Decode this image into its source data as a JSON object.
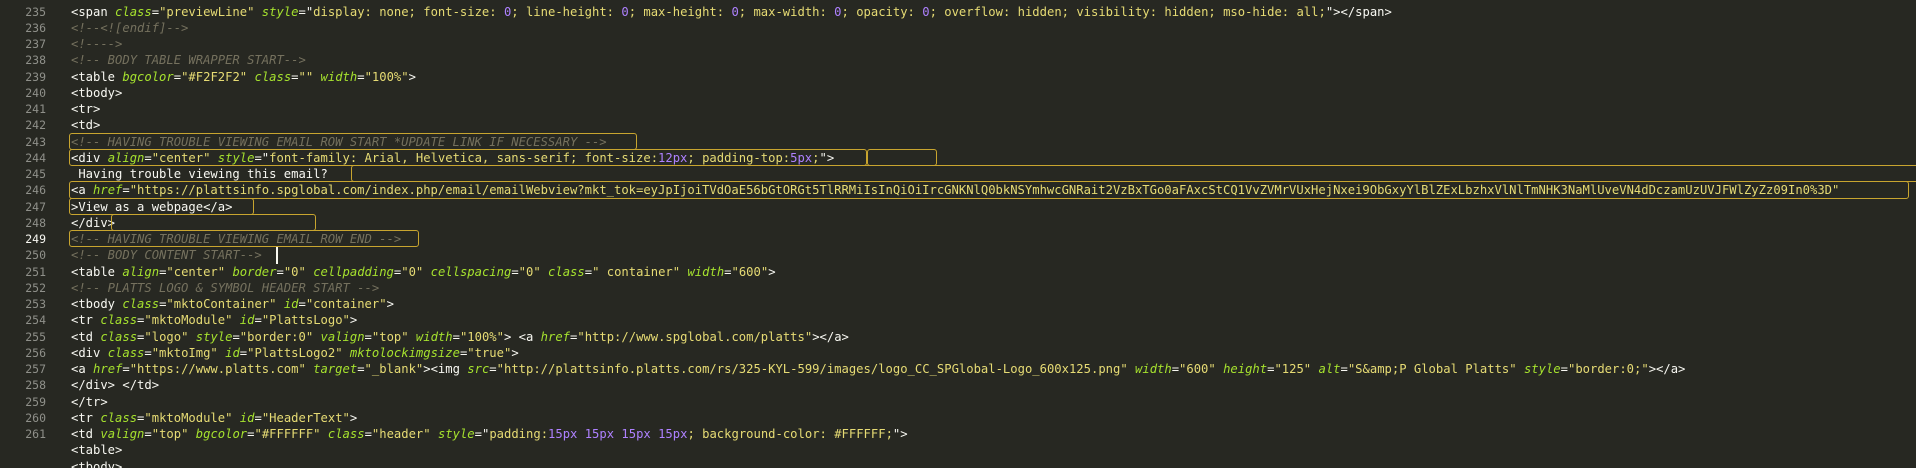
{
  "gutter": {
    "numbers": [
      "235",
      "236",
      "237",
      "238",
      "239",
      "240",
      "241",
      "242",
      "243",
      "244",
      "245",
      "246",
      "247",
      "248",
      "249",
      "250",
      "251",
      "252",
      "253",
      "254",
      "255",
      "256",
      "257",
      "258",
      "259",
      "260",
      "261"
    ],
    "active": "249"
  },
  "lines": [
    [
      [
        "t",
        "<span "
      ],
      [
        "a",
        "class"
      ],
      [
        "t",
        "="
      ],
      [
        "s",
        "\"previewLine\""
      ],
      [
        "t",
        " "
      ],
      [
        "a",
        "style"
      ],
      [
        "t",
        "=\""
      ],
      [
        "s",
        "display: none; font-size: "
      ],
      [
        "n",
        "0"
      ],
      [
        "s",
        "; line-height: "
      ],
      [
        "n",
        "0"
      ],
      [
        "s",
        "; max-height: "
      ],
      [
        "n",
        "0"
      ],
      [
        "s",
        "; max-width: "
      ],
      [
        "n",
        "0"
      ],
      [
        "s",
        "; opacity: "
      ],
      [
        "n",
        "0"
      ],
      [
        "s",
        "; overflow: hidden; visibility: hidden; mso-hide: all;"
      ],
      [
        "t",
        "\"></span>"
      ]
    ],
    [
      [
        "c",
        "<!--<![endif]-->"
      ]
    ],
    [
      [
        "c",
        "<!---->"
      ]
    ],
    [
      [
        "c",
        "<!-- BODY TABLE WRAPPER START-->"
      ]
    ],
    [
      [
        "t",
        "<table "
      ],
      [
        "a",
        "bgcolor"
      ],
      [
        "t",
        "="
      ],
      [
        "s",
        "\"#F2F2F2\""
      ],
      [
        "t",
        " "
      ],
      [
        "a",
        "class"
      ],
      [
        "t",
        "="
      ],
      [
        "s",
        "\"\""
      ],
      [
        "t",
        " "
      ],
      [
        "a",
        "width"
      ],
      [
        "t",
        "="
      ],
      [
        "s",
        "\"100%\""
      ],
      [
        "t",
        ">"
      ]
    ],
    [
      [
        "t",
        "<tbody>"
      ]
    ],
    [
      [
        "t",
        "<tr>"
      ]
    ],
    [
      [
        "t",
        "<td>"
      ]
    ],
    [
      [
        "c",
        "<!-- HAVING TROUBLE VIEWING EMAIL ROW START *UPDATE LINK IF NECESSARY -->"
      ]
    ],
    [
      [
        "t",
        "<div "
      ],
      [
        "a",
        "align"
      ],
      [
        "t",
        "="
      ],
      [
        "s",
        "\"center\""
      ],
      [
        "t",
        " "
      ],
      [
        "a",
        "style"
      ],
      [
        "t",
        "=\""
      ],
      [
        "s",
        "font-family: Arial, Helvetica, sans-serif; font-size:"
      ],
      [
        "n",
        "12px"
      ],
      [
        "s",
        "; padding-top:"
      ],
      [
        "n",
        "5px"
      ],
      [
        "s",
        ";"
      ],
      [
        "t",
        "\">"
      ]
    ],
    [
      [
        "t",
        " Having trouble viewing this email?"
      ]
    ],
    [
      [
        "t",
        "<a "
      ],
      [
        "a",
        "href"
      ],
      [
        "t",
        "="
      ],
      [
        "s",
        "\"https://plattsinfo.spglobal.com/index.php/email/emailWebview?mkt_tok=eyJpIjoiTVdOaE56bGtORGt5TlRRMiIsInQiOiIrcGNKNlQ0bkNSYmhwcGNRait2VzBxTGo0aFAxcStCQ1VvZVMrVUxHejNxei9ObGxyYlBlZExLbzhxVlNlTmNHK3NaMlUveVN4dDczamUzUVJFWlZyZz09In0%3D\""
      ]
    ],
    [
      [
        "t",
        ">View as a webpage</a>"
      ]
    ],
    [
      [
        "t",
        "</div>"
      ]
    ],
    [
      [
        "c",
        "<!-- HAVING TROUBLE VIEWING EMAIL ROW END -->"
      ]
    ],
    [
      [
        "c",
        "<!-- BODY CONTENT START-->"
      ]
    ],
    [
      [
        "t",
        "<table "
      ],
      [
        "a",
        "align"
      ],
      [
        "t",
        "="
      ],
      [
        "s",
        "\"center\""
      ],
      [
        "t",
        " "
      ],
      [
        "a",
        "border"
      ],
      [
        "t",
        "="
      ],
      [
        "s",
        "\"0\""
      ],
      [
        "t",
        " "
      ],
      [
        "a",
        "cellpadding"
      ],
      [
        "t",
        "="
      ],
      [
        "s",
        "\"0\""
      ],
      [
        "t",
        " "
      ],
      [
        "a",
        "cellspacing"
      ],
      [
        "t",
        "="
      ],
      [
        "s",
        "\"0\""
      ],
      [
        "t",
        " "
      ],
      [
        "a",
        "class"
      ],
      [
        "t",
        "="
      ],
      [
        "s",
        "\" container\""
      ],
      [
        "t",
        " "
      ],
      [
        "a",
        "width"
      ],
      [
        "t",
        "="
      ],
      [
        "s",
        "\"600\""
      ],
      [
        "t",
        ">"
      ]
    ],
    [
      [
        "c",
        "<!-- PLATTS LOGO & SYMBOL HEADER START -->"
      ]
    ],
    [
      [
        "t",
        "<tbody "
      ],
      [
        "a",
        "class"
      ],
      [
        "t",
        "="
      ],
      [
        "s",
        "\"mktoContainer\""
      ],
      [
        "t",
        " "
      ],
      [
        "a",
        "id"
      ],
      [
        "t",
        "="
      ],
      [
        "s",
        "\"container\""
      ],
      [
        "t",
        ">"
      ]
    ],
    [
      [
        "t",
        "<tr "
      ],
      [
        "a",
        "class"
      ],
      [
        "t",
        "="
      ],
      [
        "s",
        "\"mktoModule\""
      ],
      [
        "t",
        " "
      ],
      [
        "a",
        "id"
      ],
      [
        "t",
        "="
      ],
      [
        "s",
        "\"PlattsLogo\""
      ],
      [
        "t",
        ">"
      ]
    ],
    [
      [
        "t",
        "<td "
      ],
      [
        "a",
        "class"
      ],
      [
        "t",
        "="
      ],
      [
        "s",
        "\"logo\""
      ],
      [
        "t",
        " "
      ],
      [
        "a",
        "style"
      ],
      [
        "t",
        "="
      ],
      [
        "s",
        "\"border:0\""
      ],
      [
        "t",
        " "
      ],
      [
        "a",
        "valign"
      ],
      [
        "t",
        "="
      ],
      [
        "s",
        "\"top\""
      ],
      [
        "t",
        " "
      ],
      [
        "a",
        "width"
      ],
      [
        "t",
        "="
      ],
      [
        "s",
        "\"100%\""
      ],
      [
        "t",
        "> <a "
      ],
      [
        "a",
        "href"
      ],
      [
        "t",
        "="
      ],
      [
        "s",
        "\"http://www.spglobal.com/platts\""
      ],
      [
        "t",
        "></a>"
      ]
    ],
    [
      [
        "t",
        "<div "
      ],
      [
        "a",
        "class"
      ],
      [
        "t",
        "="
      ],
      [
        "s",
        "\"mktoImg\""
      ],
      [
        "t",
        " "
      ],
      [
        "a",
        "id"
      ],
      [
        "t",
        "="
      ],
      [
        "s",
        "\"PlattsLogo2\""
      ],
      [
        "t",
        " "
      ],
      [
        "a",
        "mktolockimgsize"
      ],
      [
        "t",
        "="
      ],
      [
        "s",
        "\"true\""
      ],
      [
        "t",
        ">"
      ]
    ],
    [
      [
        "t",
        "<a "
      ],
      [
        "a",
        "href"
      ],
      [
        "t",
        "="
      ],
      [
        "s",
        "\"https://www.platts.com\""
      ],
      [
        "t",
        " "
      ],
      [
        "a",
        "target"
      ],
      [
        "t",
        "="
      ],
      [
        "s",
        "\"_blank\""
      ],
      [
        "t",
        "><img "
      ],
      [
        "a",
        "src"
      ],
      [
        "t",
        "="
      ],
      [
        "s",
        "\"http://plattsinfo.platts.com/rs/325-KYL-599/images/logo_CC_SPGlobal-Logo_600x125.png\""
      ],
      [
        "t",
        " "
      ],
      [
        "a",
        "width"
      ],
      [
        "t",
        "="
      ],
      [
        "s",
        "\"600\""
      ],
      [
        "t",
        " "
      ],
      [
        "a",
        "height"
      ],
      [
        "t",
        "="
      ],
      [
        "s",
        "\"125\""
      ],
      [
        "t",
        " "
      ],
      [
        "a",
        "alt"
      ],
      [
        "t",
        "="
      ],
      [
        "s",
        "\"S&amp;P Global Platts\""
      ],
      [
        "t",
        " "
      ],
      [
        "a",
        "style"
      ],
      [
        "t",
        "="
      ],
      [
        "s",
        "\"border:0;\""
      ],
      [
        "t",
        "></a>"
      ]
    ],
    [
      [
        "t",
        "</div> </td>"
      ]
    ],
    [
      [
        "t",
        "</tr>"
      ]
    ],
    [
      [
        "t",
        "<tr "
      ],
      [
        "a",
        "class"
      ],
      [
        "t",
        "="
      ],
      [
        "s",
        "\"mktoModule\""
      ],
      [
        "t",
        " "
      ],
      [
        "a",
        "id"
      ],
      [
        "t",
        "="
      ],
      [
        "s",
        "\"HeaderText\""
      ],
      [
        "t",
        ">"
      ]
    ],
    [
      [
        "t",
        "<td "
      ],
      [
        "a",
        "valign"
      ],
      [
        "t",
        "="
      ],
      [
        "s",
        "\"top\""
      ],
      [
        "t",
        " "
      ],
      [
        "a",
        "bgcolor"
      ],
      [
        "t",
        "="
      ],
      [
        "s",
        "\"#FFFFFF\""
      ],
      [
        "t",
        " "
      ],
      [
        "a",
        "class"
      ],
      [
        "t",
        "="
      ],
      [
        "s",
        "\"header\""
      ],
      [
        "t",
        " "
      ],
      [
        "a",
        "style"
      ],
      [
        "t",
        "=\""
      ],
      [
        "s",
        "padding:"
      ],
      [
        "n",
        "15px 15px 15px 15px"
      ],
      [
        "s",
        "; background-color: #FFFFFF;"
      ],
      [
        "t",
        "\">"
      ]
    ],
    [
      [
        "t",
        "<table>"
      ]
    ],
    [
      [
        "t",
        "<tbody>"
      ]
    ]
  ],
  "colors": {
    "background": "#272822",
    "text": "#f8f8f2",
    "comment": "#75715e",
    "attribute": "#a6e22e",
    "string": "#e6db74",
    "number": "#ae81ff",
    "highlight_border": "#c8a52f"
  }
}
